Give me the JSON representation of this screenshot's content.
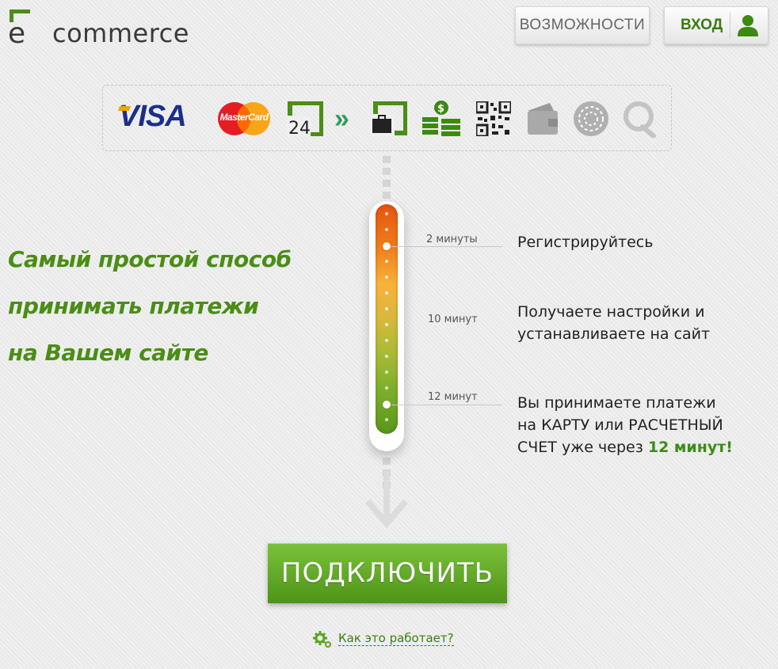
{
  "header": {
    "logo_letter": "e",
    "logo_text": "commerce",
    "features_label": "ВОЗМОЖНОСТИ",
    "login_label": "ВХОД"
  },
  "payments": {
    "visa_label": "VISA",
    "mastercard_label": "MasterCard",
    "privat24_label": "24",
    "chevron_label": "»",
    "methods": [
      "visa-icon",
      "mastercard-icon",
      "privat24-icon",
      "chevron-icon",
      "wallet-icon",
      "cash-icon",
      "qr-code-icon",
      "card-icon",
      "webmoney-icon",
      "qiwi-icon"
    ]
  },
  "headline": {
    "line1": "Самый простой способ",
    "line2": "принимать платежи",
    "line3": "на Вашем сайте"
  },
  "steps": [
    {
      "time": "2 минуты",
      "text": "Регистрируйтесь"
    },
    {
      "time": "10 минут",
      "text_line1": "Получаете настройки и",
      "text_line2": "устанавливаете на сайт"
    },
    {
      "time": "12 минут",
      "text_line1": "Вы принимаете платежи",
      "text_line2": "на КАРТУ или РАСЧЕТНЫЙ",
      "text_line3_pre": "СЧЕТ уже через ",
      "text_line3_hl": "12 минут!"
    }
  ],
  "cta": {
    "connect_label": "ПОДКЛЮЧИТЬ",
    "how_label": "Как это работает?"
  },
  "colors": {
    "brand_green": "#4b8d16",
    "cta_green": "#5ea526",
    "visa_blue": "#1a2f8c",
    "accent_orange": "#e5540f"
  }
}
